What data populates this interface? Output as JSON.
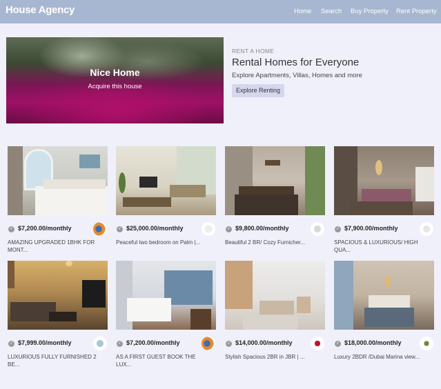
{
  "nav": {
    "brand": "House Agency",
    "links": [
      "Home",
      "Search",
      "Buy Property",
      "Rent Property"
    ]
  },
  "hero": {
    "title": "Nice Home",
    "subtitle": "Acquire this house",
    "eyebrow": "RENT A HOME",
    "headline": "Rental Homes for Everyone",
    "lead": "Explore Apartments, Villas, Homes and more",
    "button": "Explore Renting"
  },
  "listings": [
    {
      "price": "$7,200.00/monthly",
      "description": "AMAZING UPGRADED 1BHK FOR MONT...",
      "photo": "bedroom-photo",
      "logo": "agency-logo"
    },
    {
      "price": "$25,000.00/monthly",
      "description": "Peaceful two bedroom on Palm |...",
      "photo": "living-room-photo",
      "logo": "agency-logo"
    },
    {
      "price": "$9,800.00/monthly",
      "description": "Beautiful 2 BR/ Cozy Furnicher...",
      "photo": "dining-room-photo",
      "logo": "agency-logo"
    },
    {
      "price": "$7,900.00/monthly",
      "description": "SPACIOUS & LUXURIOUS/ HIGH QUA...",
      "photo": "lounge-photo",
      "logo": "agency-logo"
    },
    {
      "price": "$7,999.00/monthly",
      "description": "LUXURIOUS FULLY FURNISHED 2 BE...",
      "photo": "living-room-photo",
      "logo": "agency-logo"
    },
    {
      "price": "$7,200.00/monthly",
      "description": "AS A FIRST GUEST BOOK THE LUX...",
      "photo": "bedroom-photo",
      "logo": "agency-logo"
    },
    {
      "price": "$14,000.00/monthly",
      "description": "Stylish Spacious 2BR in JBR | ...",
      "photo": "living-room-photo",
      "logo": "agency-logo"
    },
    {
      "price": "$18,000.00/monthly",
      "description": "Luxury 2BDR /Dubai Marina view...",
      "photo": "bedroom-photo",
      "logo": "agency-logo"
    }
  ],
  "colors": {
    "navbar": "#a8b7d1",
    "background": "#f0f0fb",
    "button": "#d6d7ec"
  },
  "icons": {
    "verified": "check-circle-icon"
  }
}
